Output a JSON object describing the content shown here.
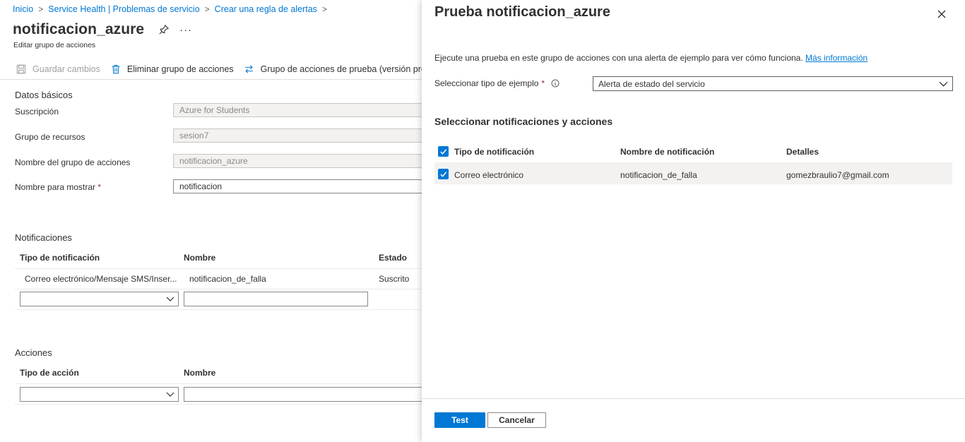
{
  "breadcrumb": [
    "Inicio",
    "Service Health | Problemas de servicio",
    "Crear una regla de alertas"
  ],
  "page": {
    "title": "notificacion_azure",
    "subtitle": "Editar grupo de acciones"
  },
  "toolbar": {
    "save_label": "Guardar cambios",
    "delete_label": "Eliminar grupo de acciones",
    "test_label": "Grupo de acciones de prueba (versión preliminar)"
  },
  "basics": {
    "section": "Datos básicos",
    "subscription_label": "Suscripción",
    "subscription_value": "Azure for Students",
    "resource_group_label": "Grupo de recursos",
    "resource_group_value": "sesion7",
    "action_group_name_label": "Nombre del grupo de acciones",
    "action_group_name_value": "notificacion_azure",
    "display_name_label": "Nombre para mostrar",
    "display_name_value": "notificacion",
    "required_mark": "*"
  },
  "notifications": {
    "section": "Notificaciones",
    "headers": [
      "Tipo de notificación",
      "Nombre",
      "Estado"
    ],
    "rows": [
      {
        "type": "Correo electrónico/Mensaje SMS/Inser...",
        "name": "notificacion_de_falla",
        "status": "Suscrito"
      }
    ]
  },
  "actions": {
    "section": "Acciones",
    "headers": [
      "Tipo de acción",
      "Nombre"
    ]
  },
  "panel": {
    "title": "Prueba notificacion_azure",
    "description": "Ejecute una prueba en este grupo de acciones con una alerta de ejemplo para ver cómo funciona.",
    "more_info": "Más información",
    "sample_type_label": "Seleccionar tipo de ejemplo",
    "required_mark": "*",
    "sample_type_value": "Alerta de estado del servicio",
    "select_title": "Seleccionar notificaciones y acciones",
    "headers": [
      "Tipo de notificación",
      "Nombre de notificación",
      "Detalles"
    ],
    "rows": [
      {
        "type": "Correo electrónico",
        "name": "notificacion_de_falla",
        "details": "gomezbraulio7@gmail.com"
      }
    ],
    "test_button": "Test",
    "cancel_button": "Cancelar"
  },
  "colors": {
    "accent": "#0078d4",
    "text": "#323130",
    "required": "#a4262c",
    "row_bg": "#f3f2f1"
  }
}
